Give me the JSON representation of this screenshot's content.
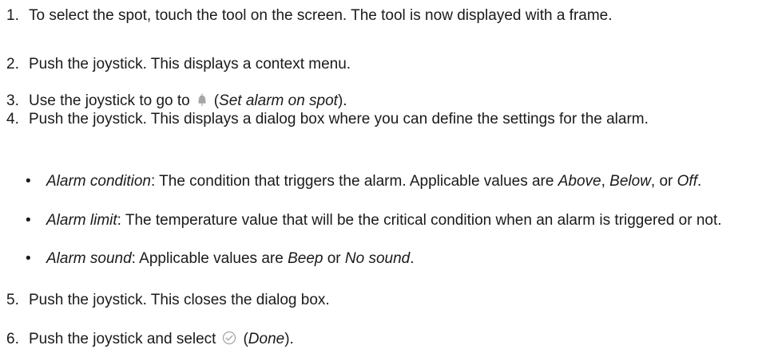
{
  "steps": [
    {
      "number": "1.",
      "text": "To select the spot, touch the tool on the screen. The tool is now displayed with a frame."
    },
    {
      "number": "2.",
      "text": "Push the joystick. This displays a context menu."
    },
    {
      "number": "3.",
      "text_before": "Use the joystick to go to",
      "icon": "bell-icon",
      "paren_open": "(",
      "icon_label": "Set alarm on spot",
      "text_after": ")."
    },
    {
      "number": "4.",
      "text": "Push the joystick. This displays a dialog box where you can define the settings for the alarm."
    },
    {
      "number": "5.",
      "text": "Push the joystick. This closes the dialog box."
    },
    {
      "number": "6.",
      "text_before": "Push the joystick and select",
      "icon": "done-check-circle-icon",
      "paren_open": "(",
      "icon_label": "Done",
      "text_after": ")."
    }
  ],
  "bullets": [
    {
      "term": "Alarm condition",
      "text_a": ": The condition that triggers the alarm. Applicable values are ",
      "v1": "Above",
      "sep1": ", ",
      "v2": "Below",
      "sep2": ", or ",
      "v3": "Off",
      "end": "."
    },
    {
      "term": "Alarm limit",
      "text": ": The temperature value that will be the critical condition when an alarm is triggered or not."
    },
    {
      "term": "Alarm sound",
      "text_a": ": Applicable values are ",
      "v1": "Beep",
      "sep1": " or ",
      "v2": "No sound",
      "end": "."
    }
  ],
  "bullet_char": "•",
  "icon_color": "#a6a6a6"
}
